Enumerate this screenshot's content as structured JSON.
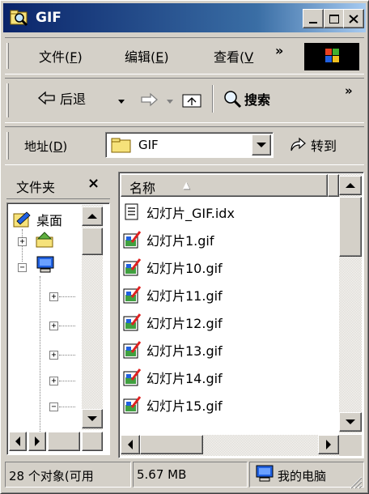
{
  "window": {
    "title": "GIF",
    "icon": "folder-search-icon"
  },
  "menu": {
    "items": [
      {
        "label": "文件(",
        "key": "F",
        "close": ")"
      },
      {
        "label": "编辑(",
        "key": "E",
        "close": ")"
      },
      {
        "label": "查看(",
        "key": "V",
        "close": ""
      }
    ],
    "chevron": "»"
  },
  "toolbar": {
    "back_label": "后退",
    "search_label": "搜索",
    "chevron": "»"
  },
  "address": {
    "label": "地址(",
    "key": "D",
    "close": ")",
    "value": "GIF",
    "go_label": "转到"
  },
  "left_pane": {
    "title": "文件夹",
    "close": "×",
    "tree_root": "桌面"
  },
  "file_list": {
    "column_header": "名称",
    "sort_indicator": "▲",
    "files": [
      {
        "name": "幻灯片_GIF.idx",
        "icon": "text-file-icon"
      },
      {
        "name": "幻灯片1.gif",
        "icon": "gif-image-icon"
      },
      {
        "name": "幻灯片10.gif",
        "icon": "gif-image-icon"
      },
      {
        "name": "幻灯片11.gif",
        "icon": "gif-image-icon"
      },
      {
        "name": "幻灯片12.gif",
        "icon": "gif-image-icon"
      },
      {
        "name": "幻灯片13.gif",
        "icon": "gif-image-icon"
      },
      {
        "name": "幻灯片14.gif",
        "icon": "gif-image-icon"
      },
      {
        "name": "幻灯片15.gif",
        "icon": "gif-image-icon"
      }
    ]
  },
  "status": {
    "objects": "28 个对象(可用",
    "size": "5.67 MB",
    "zone": "我的电脑"
  },
  "colors": {
    "title_start": "#0a246a",
    "title_end": "#a6caf0",
    "face": "#d4d0c8"
  }
}
